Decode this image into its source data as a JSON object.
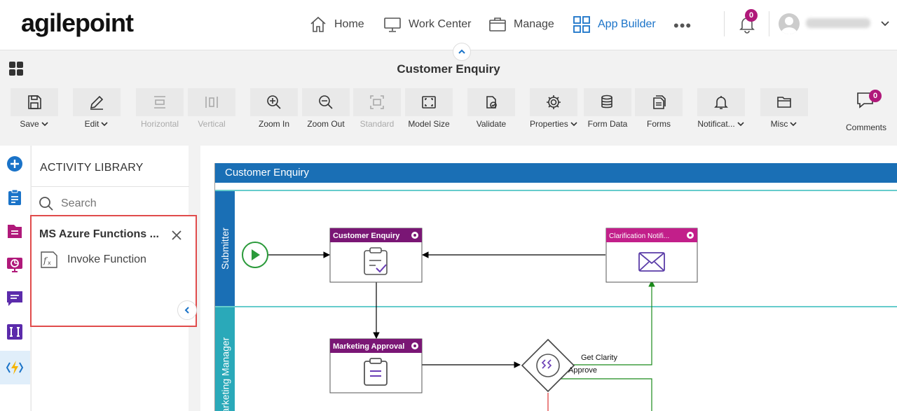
{
  "brand": {
    "logo_text": "agilepoint"
  },
  "nav": {
    "items": [
      {
        "label": "Home",
        "icon": "home-icon"
      },
      {
        "label": "Work Center",
        "icon": "monitor-icon"
      },
      {
        "label": "Manage",
        "icon": "briefcase-icon"
      },
      {
        "label": "App Builder",
        "icon": "grid-icon",
        "active": true
      }
    ],
    "more": "•••",
    "notifications_count": "0"
  },
  "page": {
    "title": "Customer Enquiry"
  },
  "toolbar": {
    "save": "Save",
    "edit": "Edit",
    "horizontal": "Horizontal",
    "vertical": "Vertical",
    "zoom_in": "Zoom In",
    "zoom_out": "Zoom Out",
    "standard": "Standard",
    "model_size": "Model Size",
    "validate": "Validate",
    "properties": "Properties",
    "form_data": "Form Data",
    "forms": "Forms",
    "notifications": "Notificat...",
    "misc": "Misc",
    "comments": "Comments",
    "comments_count": "0"
  },
  "library": {
    "title": "ACTIVITY LIBRARY",
    "search_placeholder": "Search",
    "group_title": "MS Azure Functions ...",
    "items": [
      {
        "label": "Invoke Function",
        "icon": "function-icon"
      }
    ]
  },
  "diagram": {
    "pool_title": "Customer Enquiry",
    "lanes": [
      "Submitter",
      "Marketing Manager"
    ],
    "tasks": {
      "customer_enquiry": "Customer Enquiry",
      "clarification": "Clarification Notifi...",
      "marketing_approval": "Marketing Approval"
    },
    "flow_labels": {
      "get_clarity": "Get Clarity",
      "approve": "Approve"
    }
  },
  "colors": {
    "accent": "#1a73c8",
    "brand_magenta": "#b0197a",
    "task_header": "#7a1675",
    "pool_blue": "#1a6fb5",
    "highlight_border": "#e04b4b"
  }
}
